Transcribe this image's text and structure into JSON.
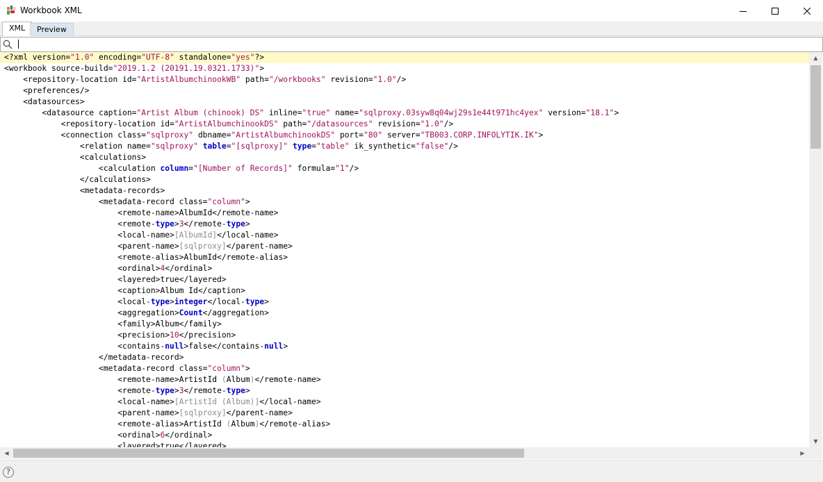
{
  "window": {
    "title": "Workbook XML",
    "app_icon": "tableau-icon",
    "controls": [
      "minimize-icon",
      "maximize-icon",
      "close-icon"
    ]
  },
  "tabs": [
    {
      "label": "XML",
      "active": true
    },
    {
      "label": "Preview",
      "active": false
    }
  ],
  "search": {
    "icon": "search-icon",
    "value": "",
    "placeholder": ""
  },
  "colors": {
    "string": "#a0135e",
    "keyword": "#0000c8",
    "highlight": "#fffac8",
    "muted": "#8c8c8c"
  },
  "xml_lines": [
    {
      "i": 0,
      "hl": true,
      "t": [
        [
          "n",
          "<?xml version="
        ],
        [
          "s",
          "\"1.0\""
        ],
        [
          "n",
          " encoding="
        ],
        [
          "s",
          "\"UTF-8\""
        ],
        [
          "n",
          " standalone="
        ],
        [
          "s",
          "\"yes\""
        ],
        [
          "n",
          "?>"
        ]
      ]
    },
    {
      "i": 0,
      "t": [
        [
          "n",
          "<workbook source-build="
        ],
        [
          "s",
          "\"2019.1.2 (20191.19.0321.1733)\""
        ],
        [
          "n",
          ">"
        ]
      ]
    },
    {
      "i": 1,
      "t": [
        [
          "n",
          "<repository-location id="
        ],
        [
          "s",
          "\"ArtistAlbumchinookWB\""
        ],
        [
          "n",
          " path="
        ],
        [
          "s",
          "\"/workbooks\""
        ],
        [
          "n",
          " revision="
        ],
        [
          "s",
          "\"1.0\""
        ],
        [
          "n",
          "/>"
        ]
      ]
    },
    {
      "i": 1,
      "t": [
        [
          "n",
          "<preferences/>"
        ]
      ]
    },
    {
      "i": 1,
      "t": [
        [
          "n",
          "<datasources>"
        ]
      ]
    },
    {
      "i": 2,
      "t": [
        [
          "n",
          "<datasource caption="
        ],
        [
          "s",
          "\"Artist Album (chinook) DS\""
        ],
        [
          "n",
          " inline="
        ],
        [
          "s",
          "\"true\""
        ],
        [
          "n",
          " name="
        ],
        [
          "s",
          "\"sqlproxy.03syw8q04wj29s1e44t971hc4yex\""
        ],
        [
          "n",
          " version="
        ],
        [
          "s",
          "\"18.1\""
        ],
        [
          "n",
          ">"
        ]
      ]
    },
    {
      "i": 3,
      "t": [
        [
          "n",
          "<repository-location id="
        ],
        [
          "s",
          "\"ArtistAlbumchinookDS\""
        ],
        [
          "n",
          " path="
        ],
        [
          "s",
          "\"/datasources\""
        ],
        [
          "n",
          " revision="
        ],
        [
          "s",
          "\"1.0\""
        ],
        [
          "n",
          "/>"
        ]
      ]
    },
    {
      "i": 3,
      "t": [
        [
          "n",
          "<connection class="
        ],
        [
          "s",
          "\"sqlproxy\""
        ],
        [
          "n",
          " dbname="
        ],
        [
          "s",
          "\"ArtistAlbumchinookDS\""
        ],
        [
          "n",
          " port="
        ],
        [
          "s",
          "\"80\""
        ],
        [
          "n",
          " server="
        ],
        [
          "s",
          "\"TB003.CORP.INFOLYTIK.IK\""
        ],
        [
          "n",
          ">"
        ]
      ]
    },
    {
      "i": 4,
      "t": [
        [
          "n",
          "<relation name="
        ],
        [
          "s",
          "\"sqlproxy\""
        ],
        [
          "n",
          " "
        ],
        [
          "k",
          "table"
        ],
        [
          "n",
          "="
        ],
        [
          "s",
          "\"[sqlproxy]\""
        ],
        [
          "n",
          " "
        ],
        [
          "k",
          "type"
        ],
        [
          "n",
          "="
        ],
        [
          "s",
          "\"table\""
        ],
        [
          "n",
          " ik_synthetic="
        ],
        [
          "s",
          "\"false\""
        ],
        [
          "n",
          "/>"
        ]
      ]
    },
    {
      "i": 4,
      "t": [
        [
          "n",
          "<calculations>"
        ]
      ]
    },
    {
      "i": 5,
      "t": [
        [
          "n",
          "<calculation "
        ],
        [
          "k",
          "column"
        ],
        [
          "n",
          "="
        ],
        [
          "s",
          "\"[Number of Records]\""
        ],
        [
          "n",
          " formula="
        ],
        [
          "s",
          "\"1\""
        ],
        [
          "n",
          "/>"
        ]
      ]
    },
    {
      "i": 4,
      "t": [
        [
          "n",
          "</calculations>"
        ]
      ]
    },
    {
      "i": 4,
      "t": [
        [
          "n",
          "<metadata-records>"
        ]
      ]
    },
    {
      "i": 5,
      "t": [
        [
          "n",
          "<metadata-record class="
        ],
        [
          "s",
          "\"column\""
        ],
        [
          "n",
          ">"
        ]
      ]
    },
    {
      "i": 6,
      "t": [
        [
          "n",
          "<remote-name>AlbumId</remote-name>"
        ]
      ]
    },
    {
      "i": 6,
      "t": [
        [
          "n",
          "<remote-"
        ],
        [
          "k",
          "type"
        ],
        [
          "n",
          ">"
        ],
        [
          "s",
          "3"
        ],
        [
          "n",
          "</remote-"
        ],
        [
          "k",
          "type"
        ],
        [
          "n",
          ">"
        ]
      ]
    },
    {
      "i": 6,
      "t": [
        [
          "n",
          "<local-name>"
        ],
        [
          "g",
          "[AlbumId]"
        ],
        [
          "n",
          "</local-name>"
        ]
      ]
    },
    {
      "i": 6,
      "t": [
        [
          "n",
          "<parent-name>"
        ],
        [
          "g",
          "[sqlproxy]"
        ],
        [
          "n",
          "</parent-name>"
        ]
      ]
    },
    {
      "i": 6,
      "t": [
        [
          "n",
          "<remote-alias>AlbumId</remote-alias>"
        ]
      ]
    },
    {
      "i": 6,
      "t": [
        [
          "n",
          "<ordinal>"
        ],
        [
          "s",
          "4"
        ],
        [
          "n",
          "</ordinal>"
        ]
      ]
    },
    {
      "i": 6,
      "t": [
        [
          "n",
          "<layered>true</layered>"
        ]
      ]
    },
    {
      "i": 6,
      "t": [
        [
          "n",
          "<caption>Album Id</caption>"
        ]
      ]
    },
    {
      "i": 6,
      "t": [
        [
          "n",
          "<local-"
        ],
        [
          "k",
          "type"
        ],
        [
          "n",
          ">"
        ],
        [
          "k",
          "integer"
        ],
        [
          "n",
          "</local-"
        ],
        [
          "k",
          "type"
        ],
        [
          "n",
          ">"
        ]
      ]
    },
    {
      "i": 6,
      "t": [
        [
          "n",
          "<aggregation>"
        ],
        [
          "k",
          "Count"
        ],
        [
          "n",
          "</aggregation>"
        ]
      ]
    },
    {
      "i": 6,
      "t": [
        [
          "n",
          "<family>Album</family>"
        ]
      ]
    },
    {
      "i": 6,
      "t": [
        [
          "n",
          "<precision>"
        ],
        [
          "s",
          "10"
        ],
        [
          "n",
          "</precision>"
        ]
      ]
    },
    {
      "i": 6,
      "t": [
        [
          "n",
          "<contains-"
        ],
        [
          "k",
          "null"
        ],
        [
          "n",
          ">false</contains-"
        ],
        [
          "k",
          "null"
        ],
        [
          "n",
          ">"
        ]
      ]
    },
    {
      "i": 5,
      "t": [
        [
          "n",
          "</metadata-record>"
        ]
      ]
    },
    {
      "i": 5,
      "t": [
        [
          "n",
          "<metadata-record class="
        ],
        [
          "s",
          "\"column\""
        ],
        [
          "n",
          ">"
        ]
      ]
    },
    {
      "i": 6,
      "t": [
        [
          "n",
          "<remote-name>ArtistId "
        ],
        [
          "g",
          "("
        ],
        [
          "n",
          "Album"
        ],
        [
          "g",
          ")"
        ],
        [
          "n",
          "</remote-name>"
        ]
      ]
    },
    {
      "i": 6,
      "t": [
        [
          "n",
          "<remote-"
        ],
        [
          "k",
          "type"
        ],
        [
          "n",
          ">"
        ],
        [
          "s",
          "3"
        ],
        [
          "n",
          "</remote-"
        ],
        [
          "k",
          "type"
        ],
        [
          "n",
          ">"
        ]
      ]
    },
    {
      "i": 6,
      "t": [
        [
          "n",
          "<local-name>"
        ],
        [
          "g",
          "[ArtistId (Album)]"
        ],
        [
          "n",
          "</local-name>"
        ]
      ]
    },
    {
      "i": 6,
      "t": [
        [
          "n",
          "<parent-name>"
        ],
        [
          "g",
          "[sqlproxy]"
        ],
        [
          "n",
          "</parent-name>"
        ]
      ]
    },
    {
      "i": 6,
      "t": [
        [
          "n",
          "<remote-alias>ArtistId "
        ],
        [
          "g",
          "("
        ],
        [
          "n",
          "Album"
        ],
        [
          "g",
          ")"
        ],
        [
          "n",
          "</remote-alias>"
        ]
      ]
    },
    {
      "i": 6,
      "t": [
        [
          "n",
          "<ordinal>"
        ],
        [
          "s",
          "6"
        ],
        [
          "n",
          "</ordinal>"
        ]
      ]
    },
    {
      "i": 6,
      "t": [
        [
          "n",
          "<layered>true</layered>"
        ]
      ]
    }
  ],
  "help": {
    "label": "?"
  }
}
